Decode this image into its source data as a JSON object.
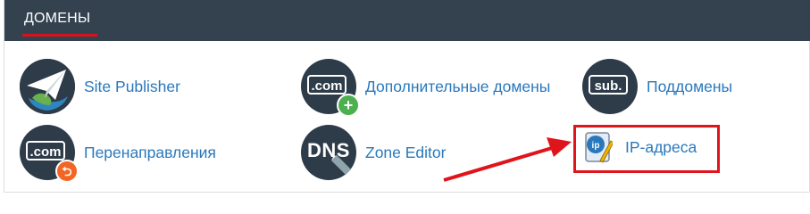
{
  "section": {
    "title": "ДОМЕНЫ"
  },
  "items": [
    {
      "label": "Site Publisher",
      "icon": "paper-plane-globe-icon"
    },
    {
      "label": "Дополнительные домены",
      "icon": "com-plus-icon",
      "tile_text": ".com"
    },
    {
      "label": "Поддомены",
      "icon": "sub-domain-icon",
      "tile_text": "sub."
    },
    {
      "label": "Перенаправления",
      "icon": "com-redirect-icon",
      "tile_text": ".com"
    },
    {
      "label": "Zone Editor",
      "icon": "dns-edit-icon",
      "tile_text": "DNS"
    },
    {
      "label": "IP-адреса",
      "icon": "ip-address-icon",
      "tile_text": "ip"
    }
  ],
  "colors": {
    "header_bg": "#344250",
    "accent_red": "#d6131c",
    "link_blue": "#2a78bc",
    "icon_bg": "#2e3b48",
    "badge_green": "#4caf50",
    "badge_orange": "#f26522"
  }
}
